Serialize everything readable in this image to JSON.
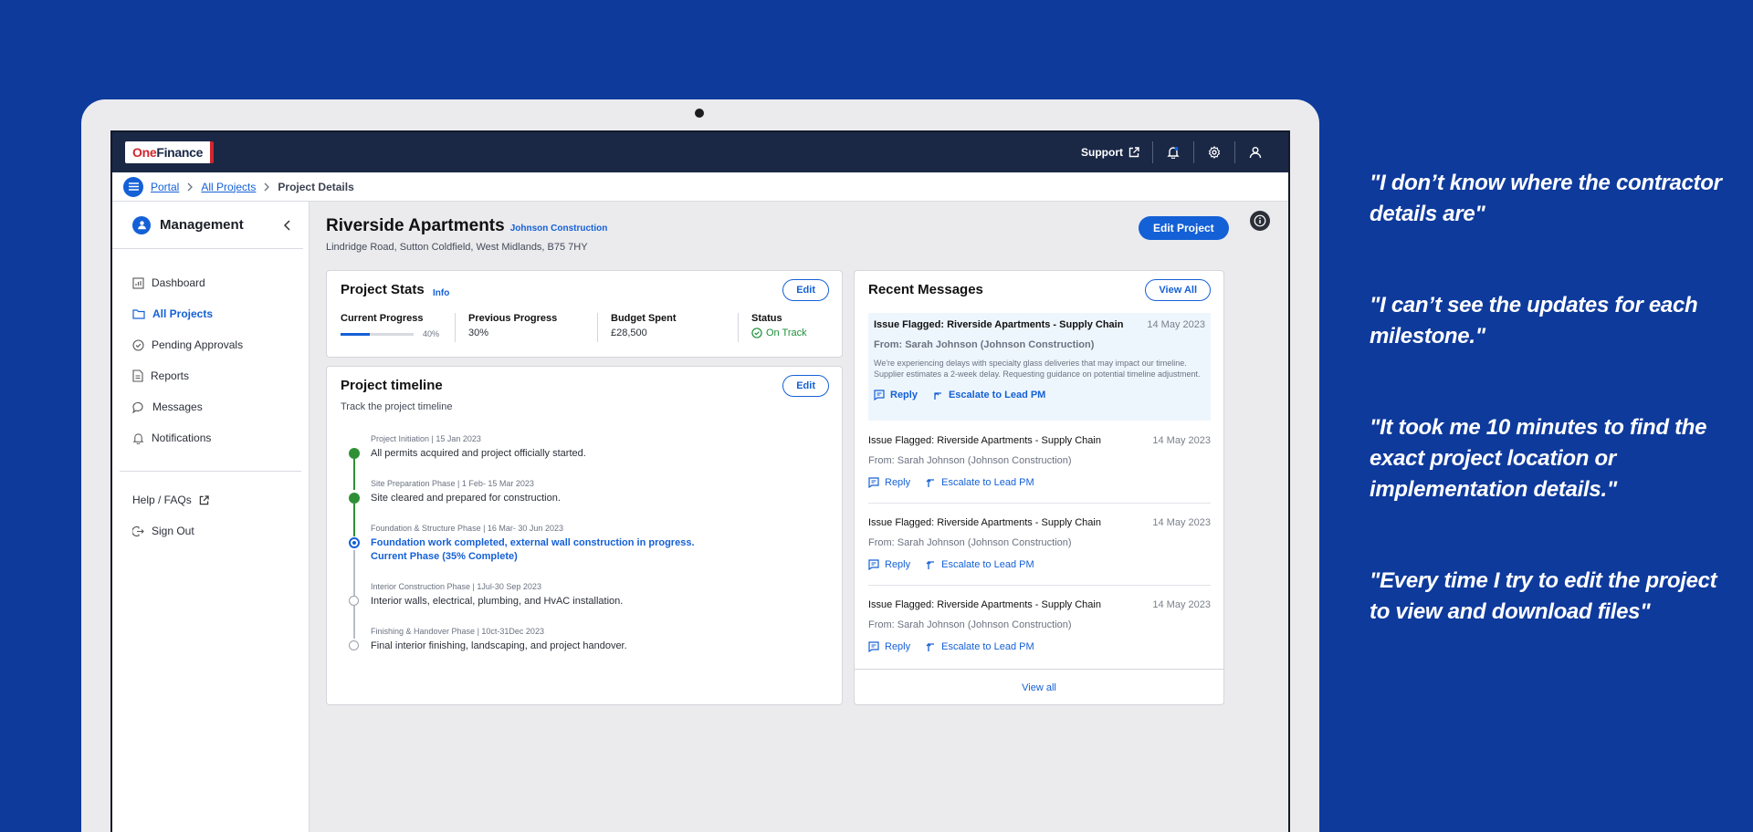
{
  "header": {
    "logo_one": "One",
    "logo_finance": "Finance",
    "support_label": "Support"
  },
  "breadcrumb": {
    "items": [
      "Portal",
      "All Projects"
    ],
    "current": "Project Details"
  },
  "sidebar": {
    "title": "Management",
    "items": [
      {
        "label": "Dashboard",
        "icon": "chart-icon"
      },
      {
        "label": "All Projects",
        "icon": "folder-icon"
      },
      {
        "label": "Pending Approvals",
        "icon": "check-circle-icon"
      },
      {
        "label": "Reports",
        "icon": "document-icon"
      },
      {
        "label": "Messages",
        "icon": "chat-icon"
      },
      {
        "label": "Notifications",
        "icon": "bell-icon"
      }
    ],
    "help_label": "Help / FAQs",
    "signout_label": "Sign Out"
  },
  "project": {
    "title": "Riverside Apartments",
    "contractor": "Johnson Construction",
    "address": "Lindridge Road, Sutton Coldfield, West Midlands, B75 7HY",
    "edit_label": "Edit Project"
  },
  "stats": {
    "title": "Project Stats",
    "info_label": "Info",
    "edit_label": "Edit",
    "current_progress_label": "Current Progress",
    "current_progress_pct": 40,
    "current_progress_text": "40%",
    "previous_progress_label": "Previous Progress",
    "previous_progress_value": "30%",
    "budget_label": "Budget Spent",
    "budget_value": "£28,500",
    "status_label": "Status",
    "status_value": "On Track"
  },
  "timeline": {
    "title": "Project timeline",
    "subtitle": "Track the project timeline",
    "edit_label": "Edit",
    "items": [
      {
        "phase": "Project Initiation | 15 Jan 2023",
        "desc": "All permits acquired and project officially started.",
        "state": "done"
      },
      {
        "phase": "Site Preparation Phase | 1 Feb- 15 Mar 2023",
        "desc": "Site cleared and prepared for construction.",
        "state": "done"
      },
      {
        "phase": "Foundation & Structure Phase | 16 Mar- 30 Jun 2023",
        "desc": "Foundation work completed, external wall construction in progress.",
        "desc2": "Current Phase (35% Complete)",
        "state": "current"
      },
      {
        "phase": "Interior Construction Phase | 1Jul-30 Sep 2023",
        "desc": "Interior walls, electrical, plumbing, and HvAC installation.",
        "state": "todo"
      },
      {
        "phase": "Finishing & Handover Phase | 10ct-31Dec 2023",
        "desc": "Final interior finishing, landscaping, and project handover.",
        "state": "todo"
      }
    ]
  },
  "messages": {
    "title": "Recent Messages",
    "view_all_label": "View All",
    "footer_label": "View all",
    "featured": {
      "subject": "Issue Flagged: Riverside Apartments - Supply Chain",
      "date": "14 May 2023",
      "from": "From: Sarah Johnson (Johnson Construction)",
      "body": "We're experiencing delays with specialty glass deliveries that may impact our timeline. Supplier estimates a 2-week delay. Requesting guidance on potential timeline adjustment.",
      "reply": "Reply",
      "escalate": "Escalate to Lead PM"
    },
    "items": [
      {
        "subject": "Issue Flagged: Riverside Apartments - Supply Chain",
        "date": "14 May 2023",
        "from": "From: Sarah Johnson (Johnson Construction)",
        "reply": "Reply",
        "escalate": "Escalate to Lead PM"
      },
      {
        "subject": "Issue Flagged: Riverside Apartments - Supply Chain",
        "date": "14 May 2023",
        "from": "From: Sarah Johnson (Johnson Construction)",
        "reply": "Reply",
        "escalate": "Escalate to Lead PM"
      },
      {
        "subject": "Issue Flagged: Riverside Apartments - Supply Chain",
        "date": "14 May 2023",
        "from": "From: Sarah Johnson (Johnson Construction)",
        "reply": "Reply",
        "escalate": "Escalate to Lead PM"
      }
    ]
  },
  "quotes": [
    "\"I don’t know where the contractor details are\"",
    "\"I can’t see the updates for each milestone.\"",
    "\"It took me 10 minutes to find the exact project location or implementation details.\"",
    "\"Every time I try to edit the project to view and download files\""
  ]
}
